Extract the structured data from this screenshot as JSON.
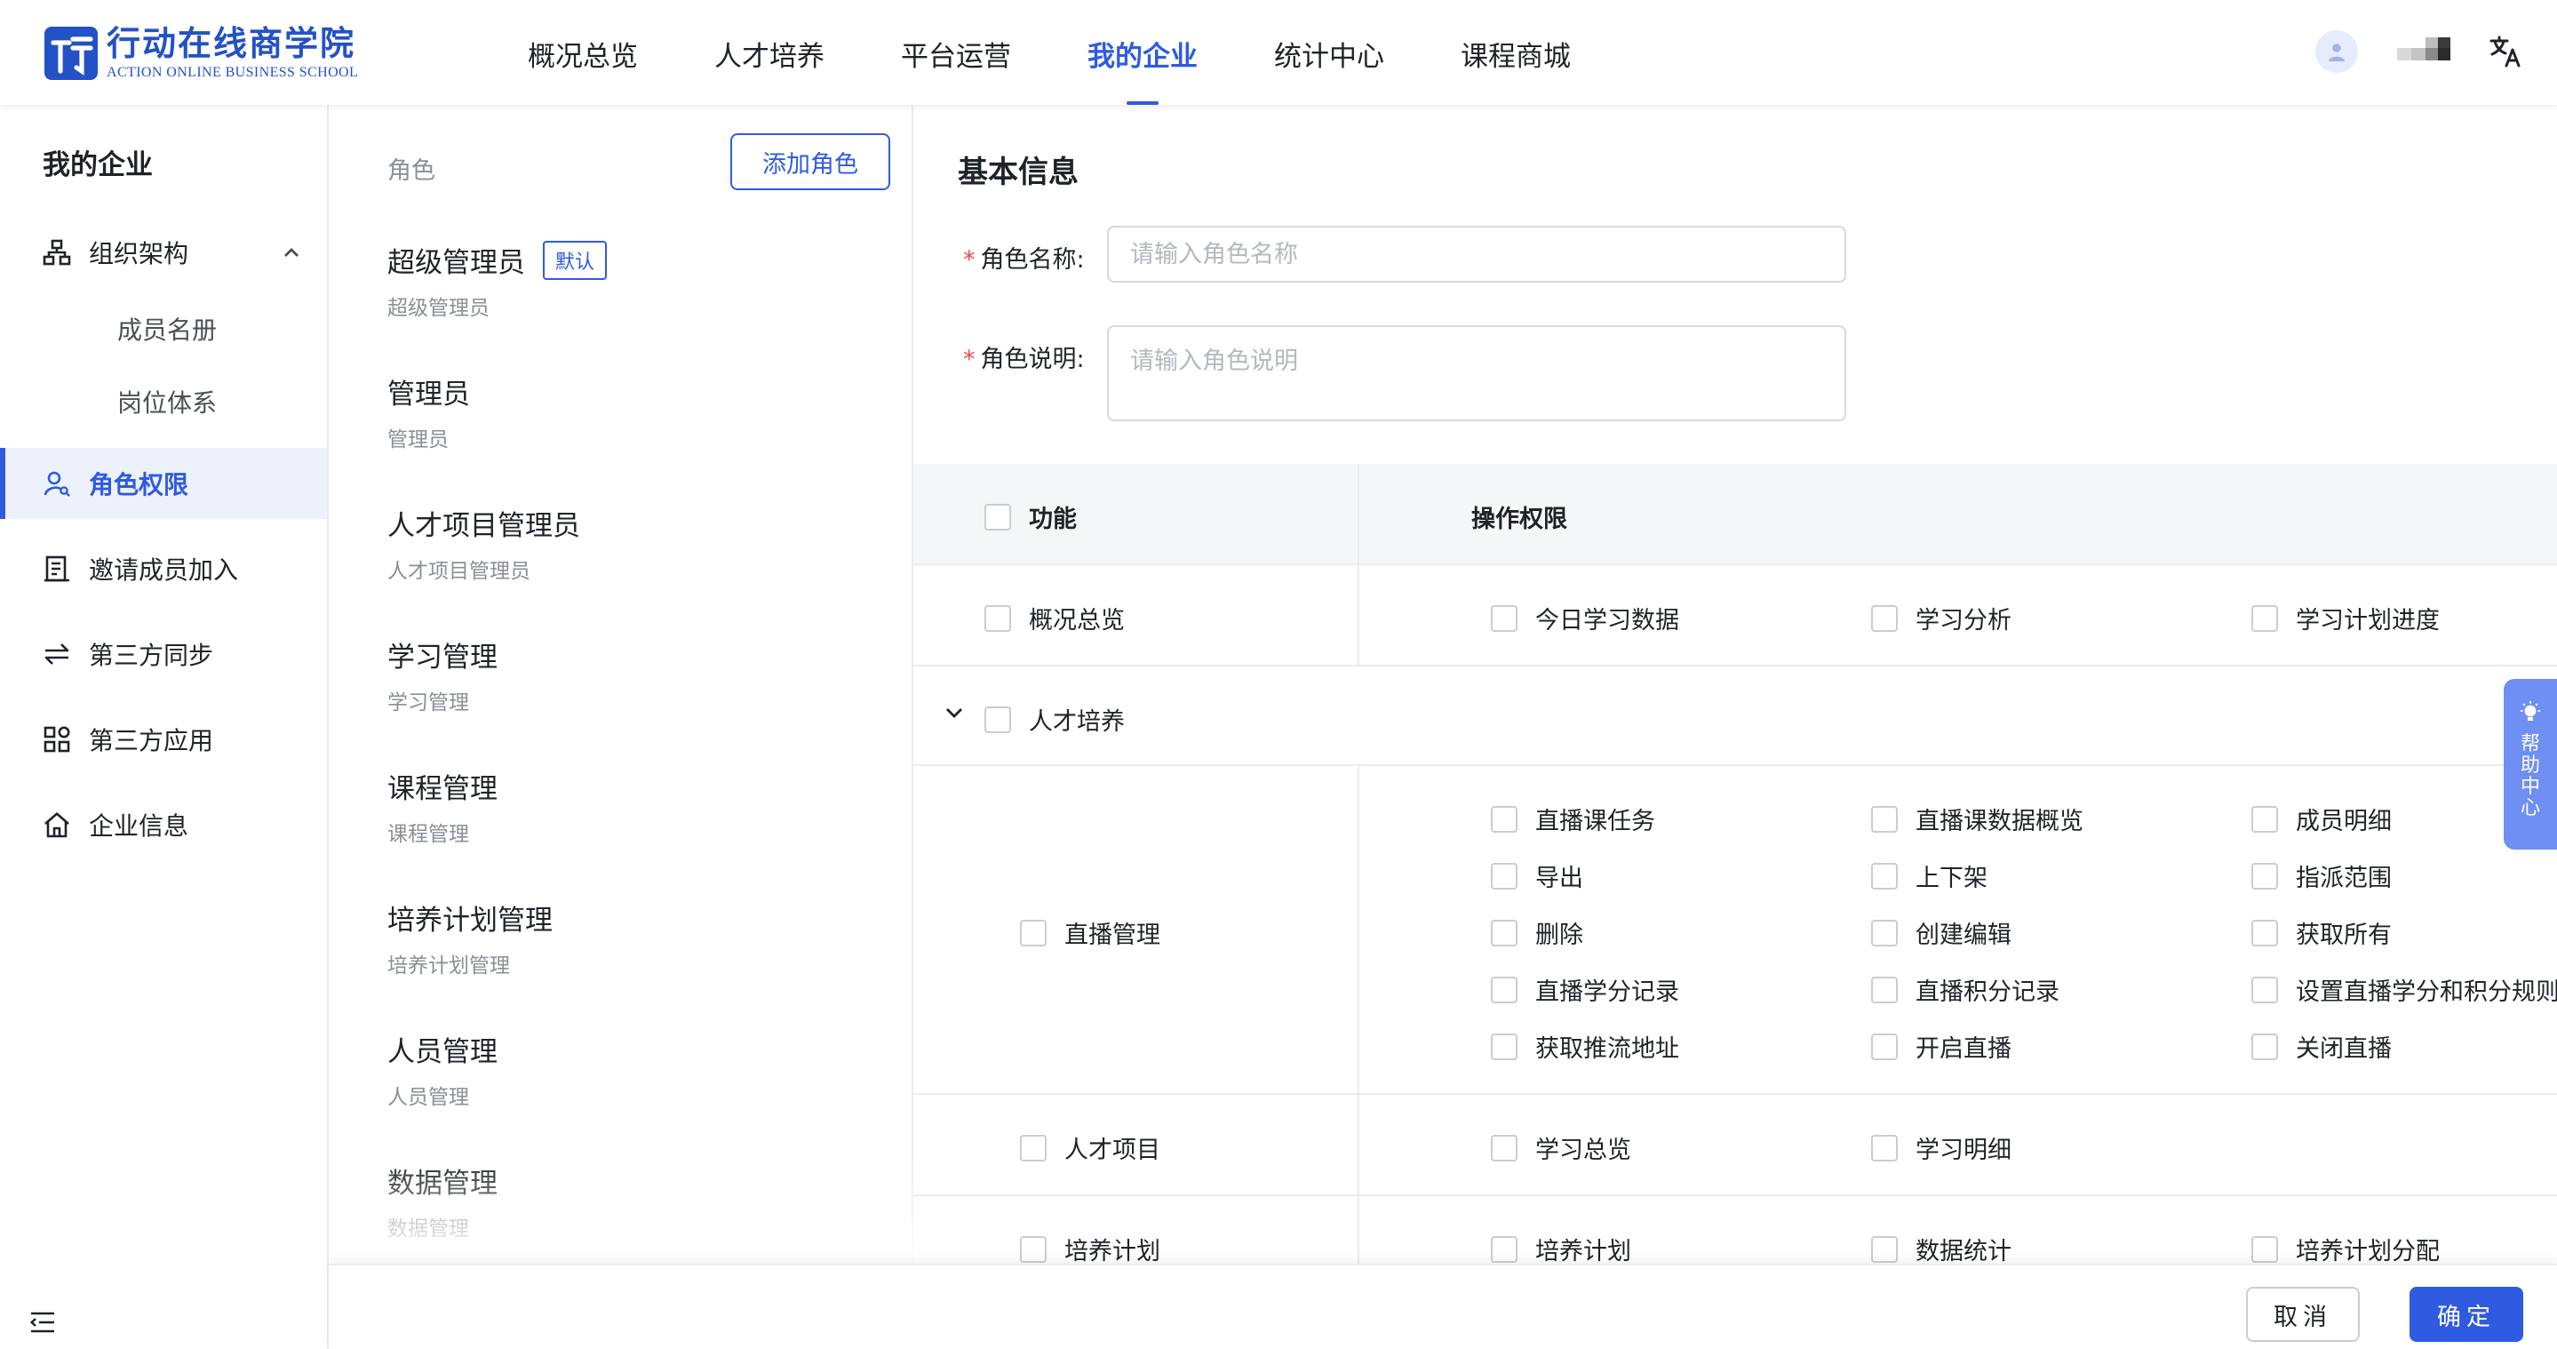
{
  "header": {
    "logo_cn": "行动在线商学院",
    "logo_en": "ACTION ONLINE BUSINESS SCHOOL",
    "nav": [
      "概况总览",
      "人才培养",
      "平台运营",
      "我的企业",
      "统计中心",
      "课程商城"
    ],
    "active_nav": "我的企业",
    "lang_icon": "translate-icon"
  },
  "sidebar": {
    "title": "我的企业",
    "org": "组织架构",
    "members": "成员名册",
    "positions": "岗位体系",
    "roles": "角色权限",
    "invite": "邀请成员加入",
    "sync": "第三方同步",
    "apps": "第三方应用",
    "company": "企业信息"
  },
  "roles": {
    "header": "角色",
    "add_label": "添加角色",
    "default_badge": "默认",
    "items": [
      {
        "name": "超级管理员",
        "desc": "超级管理员"
      },
      {
        "name": "管理员",
        "desc": "管理员"
      },
      {
        "name": "人才项目管理员",
        "desc": "人才项目管理员"
      },
      {
        "name": "学习管理",
        "desc": "学习管理"
      },
      {
        "name": "课程管理",
        "desc": "课程管理"
      },
      {
        "name": "培养计划管理",
        "desc": "培养计划管理"
      },
      {
        "name": "人员管理",
        "desc": "人员管理"
      },
      {
        "name": "数据管理",
        "desc": "数据管理"
      }
    ]
  },
  "form": {
    "title": "基本信息",
    "name_label": "角色名称:",
    "name_placeholder": "请输入角色名称",
    "desc_label": "角色说明:",
    "desc_placeholder": "请输入角色说明"
  },
  "permissions": {
    "col_function": "功能",
    "col_ops": "操作权限",
    "overview": {
      "name": "概况总览",
      "ops": [
        "今日学习数据",
        "学习分析",
        "学习计划进度"
      ]
    },
    "talent": {
      "name": "人才培养"
    },
    "live": {
      "name": "直播管理",
      "ops": [
        "直播课任务",
        "直播课数据概览",
        "成员明细",
        "导出",
        "上下架",
        "指派范围",
        "删除",
        "创建编辑",
        "获取所有",
        "直播学分记录",
        "直播积分记录",
        "设置直播学分和积分规则",
        "获取推流地址",
        "开启直播",
        "关闭直播"
      ]
    },
    "project": {
      "name": "人才项目",
      "ops": [
        "学习总览",
        "学习明细"
      ]
    },
    "plan": {
      "name": "培养计划",
      "ops": [
        "培养计划",
        "数据统计",
        "培养计划分配"
      ]
    }
  },
  "help": {
    "label": "帮助中心"
  },
  "footer": {
    "cancel": "取消",
    "confirm": "确定"
  },
  "colors": {
    "primary": "#2f5be0",
    "required": "#f54a45",
    "help_bg": "#6f8ff5"
  }
}
